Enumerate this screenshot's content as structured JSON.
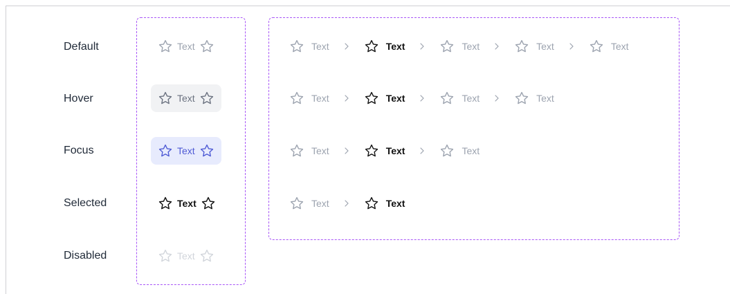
{
  "states": [
    {
      "key": "default",
      "label": "Default"
    },
    {
      "key": "hover",
      "label": "Hover"
    },
    {
      "key": "focus",
      "label": "Focus"
    },
    {
      "key": "selected",
      "label": "Selected"
    },
    {
      "key": "disabled",
      "label": "Disabled"
    }
  ],
  "item_text": "Text",
  "icons": {
    "leading": "star-icon",
    "trailing": "star-icon",
    "separator": "chevron-right-icon"
  },
  "colors": {
    "default_text": "#9ca3af",
    "hover_bg": "#f1f2f4",
    "focus_text": "#4f5bd5",
    "focus_bg": "#e7ebfd",
    "selected_text": "#111111",
    "disabled_text": "#d1d5db",
    "dashed_border": "#a855f7"
  },
  "trails": [
    {
      "items": [
        {
          "text": "Text",
          "active": false
        },
        {
          "text": "Text",
          "active": true
        },
        {
          "text": "Text",
          "active": false
        },
        {
          "text": "Text",
          "active": false
        },
        {
          "text": "Text",
          "active": false
        }
      ]
    },
    {
      "items": [
        {
          "text": "Text",
          "active": false
        },
        {
          "text": "Text",
          "active": true
        },
        {
          "text": "Text",
          "active": false
        },
        {
          "text": "Text",
          "active": false
        }
      ]
    },
    {
      "items": [
        {
          "text": "Text",
          "active": false
        },
        {
          "text": "Text",
          "active": true
        },
        {
          "text": "Text",
          "active": false
        }
      ]
    },
    {
      "items": [
        {
          "text": "Text",
          "active": false
        },
        {
          "text": "Text",
          "active": true
        }
      ]
    }
  ]
}
